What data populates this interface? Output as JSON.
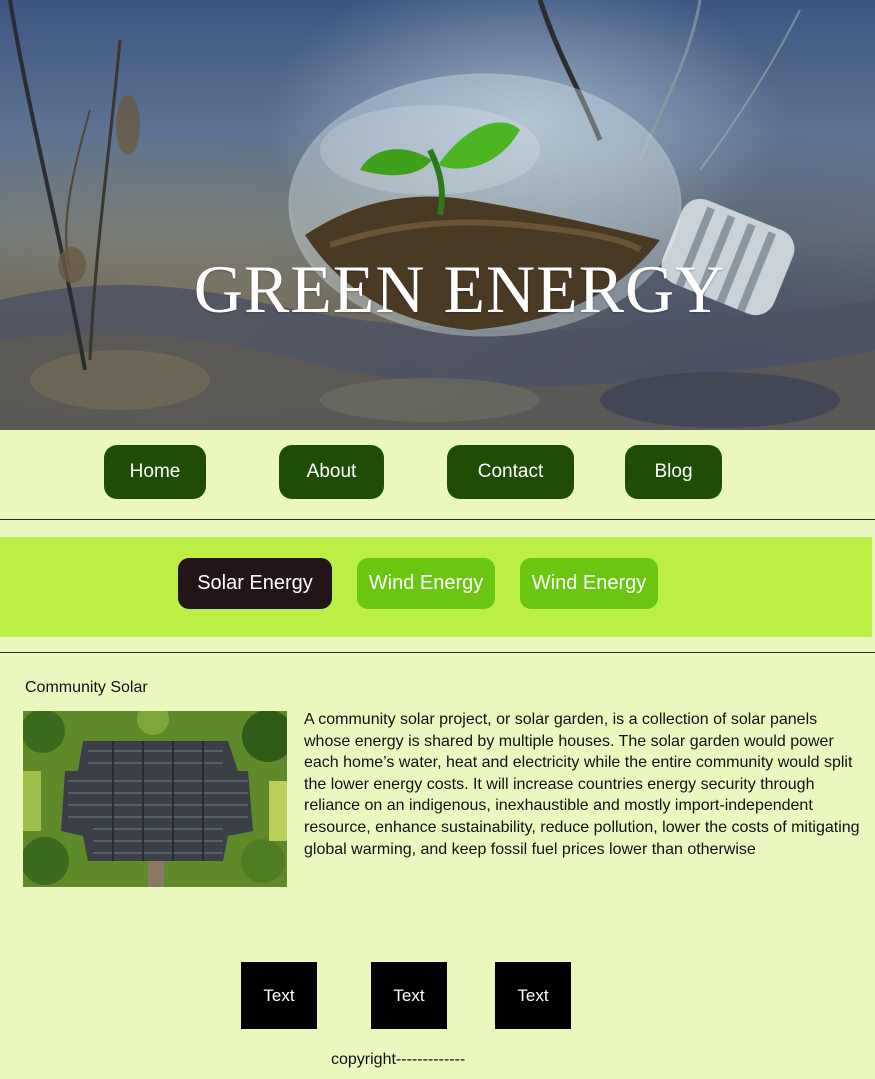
{
  "hero": {
    "title": "GREEN ENERGY"
  },
  "nav": {
    "items": [
      {
        "label": "Home"
      },
      {
        "label": "About"
      },
      {
        "label": "Contact"
      },
      {
        "label": "Blog"
      }
    ]
  },
  "tabs": {
    "items": [
      {
        "label": "Solar Energy",
        "active": true
      },
      {
        "label": "Wind Energy",
        "active": false
      },
      {
        "label": "Wind Energy",
        "active": false
      }
    ]
  },
  "content": {
    "title": "Community Solar",
    "body": "A community solar project, or solar garden, is a collection of solar panels whose energy is shared by multiple houses. The solar garden would power each home’s water, heat and electricity while the entire community would split the lower energy costs. It will increase countries energy security through reliance on an indigenous, inexhaustible and mostly import-independent resource, enhance sustainability, reduce pollution, lower the costs of mitigating global warming, and keep fossil fuel prices lower than otherwise"
  },
  "footer": {
    "buttons": [
      {
        "label": "Text"
      },
      {
        "label": "Text"
      },
      {
        "label": "Text"
      }
    ],
    "copyright": "copyright-------------"
  },
  "colors": {
    "page_background": "#eaf8c0",
    "nav_button": "#1f4d06",
    "tab_bar": "#bbef46",
    "tab_active": "#221417",
    "tab_inactive": "#6ac610",
    "footer_button": "#000000"
  },
  "icons": {
    "hero_image": "lightbulb-with-sprout-image",
    "content_image": "solar-panel-roof-aerial-image"
  }
}
